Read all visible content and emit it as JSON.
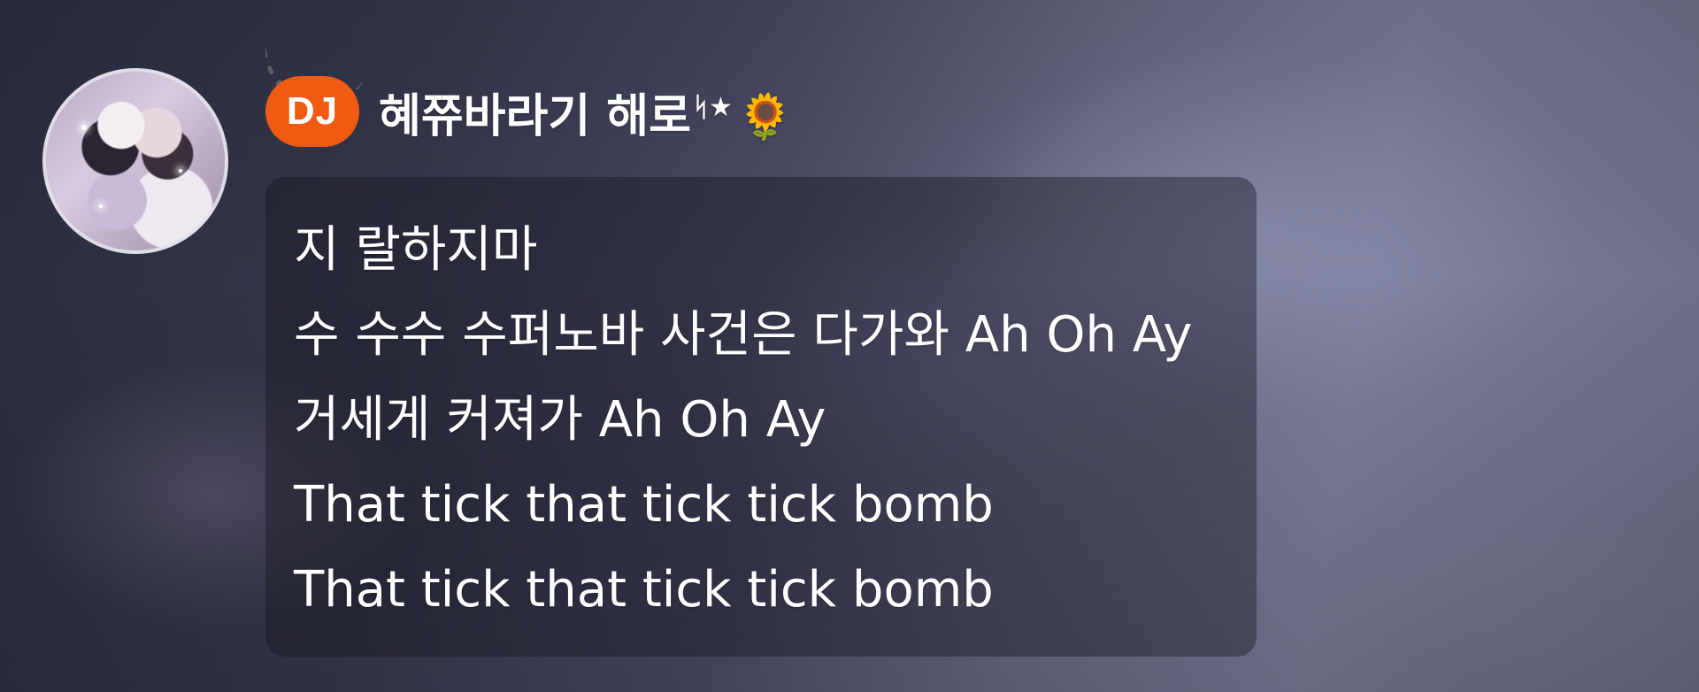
{
  "dj": {
    "badge": "DJ",
    "name": "혜쮸바라기 해로",
    "name_decor": "ᛋ★",
    "name_emoji": "🌻",
    "badge_color": "#f05a12"
  },
  "message": {
    "lines": [
      "지 랄하지마",
      "수 수수 수퍼노바 사건은 다가와 Ah Oh Ay",
      "거세게 커져가 Ah Oh Ay",
      "That tick that tick tick bomb",
      "That tick that tick tick bomb"
    ]
  }
}
